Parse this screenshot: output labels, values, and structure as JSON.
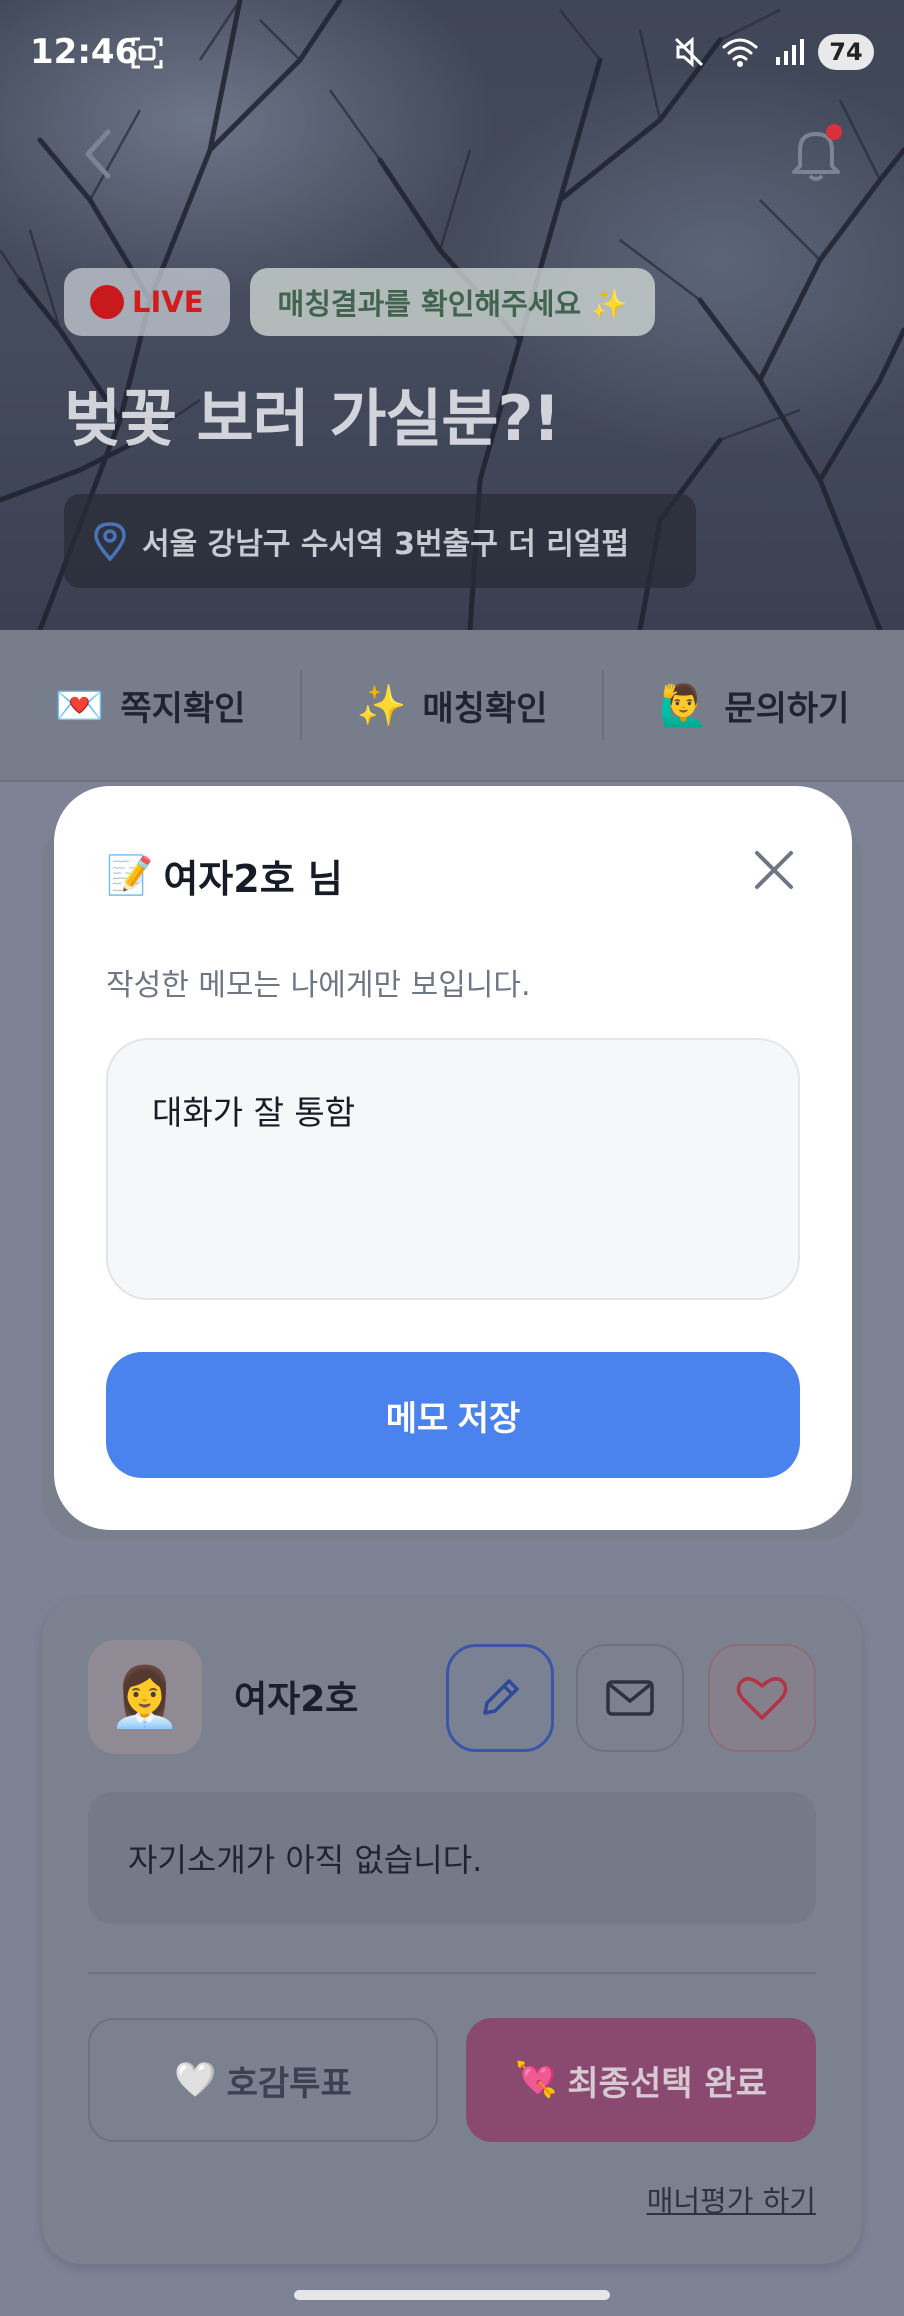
{
  "status_bar": {
    "time": "12:46",
    "battery": "74"
  },
  "hero": {
    "live_label": "LIVE",
    "match_badge": "매칭결과를 확인해주세요 ✨",
    "title": "벚꽃 보러 가실분?!",
    "location": "서울 강남구 수서역 3번출구 더 리얼펍"
  },
  "tabs": [
    {
      "emoji": "💌",
      "label": "쪽지확인"
    },
    {
      "emoji": "✨",
      "label": "매칭확인"
    },
    {
      "emoji": "🙋‍♂️",
      "label": "문의하기"
    }
  ],
  "modal": {
    "title_emoji": "📝",
    "title": "여자2호 님",
    "subtitle": "작성한 메모는 나에게만 보입니다.",
    "memo_value": "대화가 잘 통함",
    "save_label": "메모 저장"
  },
  "profile": {
    "avatar_emoji": "👩‍💼",
    "name": "여자2호",
    "intro": "자기소개가 아직 없습니다.",
    "vote_emoji": "🤍",
    "vote_label": "호감투표",
    "final_emoji": "💘",
    "final_label": "최종선택 완료",
    "manner_link": "매너평가 하기"
  },
  "colors": {
    "accent_blue": "#4b83ee",
    "final_pink": "#d6488f",
    "live_red": "#d21d1d"
  }
}
